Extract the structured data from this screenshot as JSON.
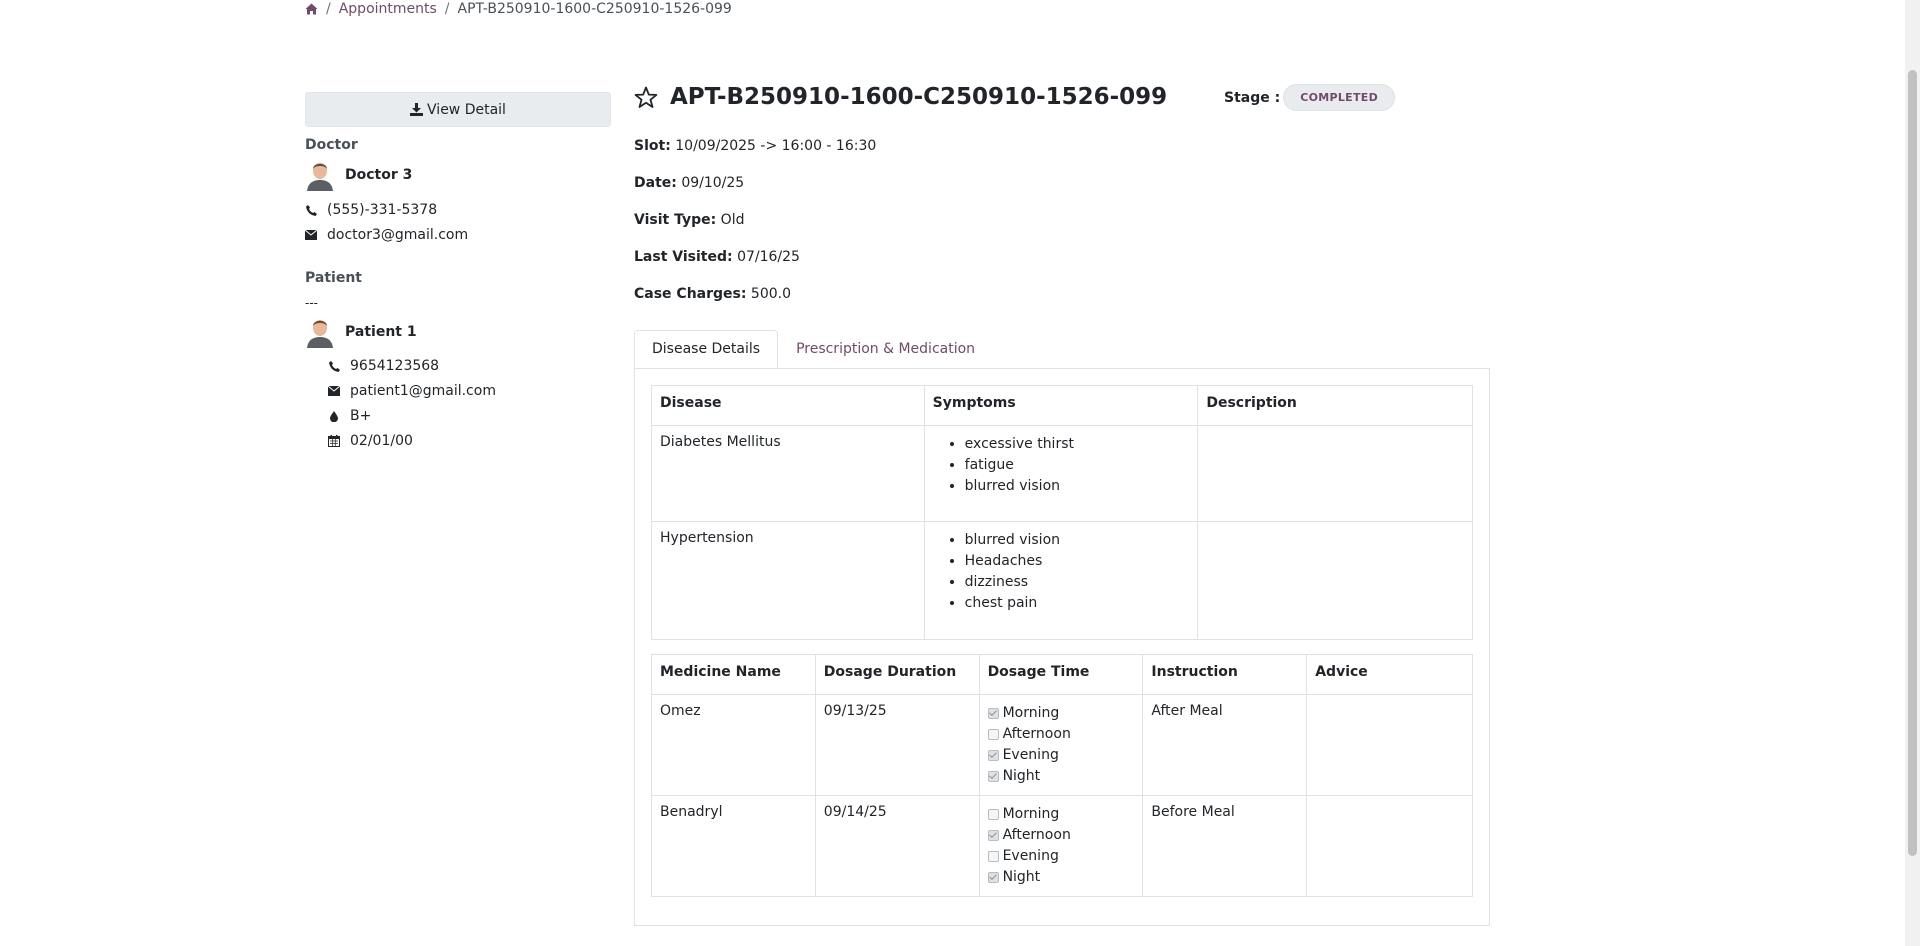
{
  "breadcrumb": {
    "home_icon": "home-icon",
    "parent": "Appointments",
    "current": "APT-B250910-1600-C250910-1526-099"
  },
  "sidebar": {
    "view_detail": "View Detail",
    "doctor_label": "Doctor",
    "doctor": {
      "name": "Doctor 3",
      "phone": "(555)-331-5378",
      "email": "doctor3@gmail.com"
    },
    "patient_label": "Patient",
    "patient_dash": "---",
    "patient": {
      "name": "Patient 1",
      "phone": "9654123568",
      "email": "patient1@gmail.com",
      "blood_group": "B+",
      "dob": "02/01/00"
    }
  },
  "header": {
    "title": "APT-B250910-1600-C250910-1526-099",
    "stage_label": "Stage :",
    "stage_value": "COMPLETED"
  },
  "fields": {
    "slot_label": "Slot:",
    "slot_value": "10/09/2025 -> 16:00 - 16:30",
    "date_label": "Date:",
    "date_value": "09/10/25",
    "visit_type_label": "Visit Type:",
    "visit_type_value": "Old",
    "last_visited_label": "Last Visited:",
    "last_visited_value": "07/16/25",
    "case_charges_label": "Case Charges:",
    "case_charges_value": "500.0"
  },
  "tabs": [
    {
      "label": "Disease Details"
    },
    {
      "label": "Prescription & Medication"
    }
  ],
  "disease_table": {
    "headers": [
      "Disease",
      "Symptoms",
      "Description"
    ],
    "rows": [
      {
        "disease": "Diabetes Mellitus",
        "symptoms": [
          "excessive thirst",
          "fatigue",
          "blurred vision"
        ],
        "description": ""
      },
      {
        "disease": "Hypertension",
        "symptoms": [
          "blurred vision",
          "Headaches",
          "dizziness",
          "chest pain"
        ],
        "description": ""
      }
    ]
  },
  "medicine_table": {
    "headers": [
      "Medicine Name",
      "Dosage Duration",
      "Dosage Time",
      "Instruction",
      "Advice"
    ],
    "time_labels": [
      "Morning",
      "Afternoon",
      "Evening",
      "Night"
    ],
    "rows": [
      {
        "name": "Omez",
        "duration": "09/13/25",
        "times": [
          true,
          false,
          true,
          true
        ],
        "instruction": "After Meal",
        "advice": ""
      },
      {
        "name": "Benadryl",
        "duration": "09/14/25",
        "times": [
          false,
          true,
          false,
          true
        ],
        "instruction": "Before Meal",
        "advice": ""
      }
    ]
  },
  "colors": {
    "accent": "#714b67",
    "border": "#dee2e6",
    "button_bg": "#e9ecef"
  }
}
